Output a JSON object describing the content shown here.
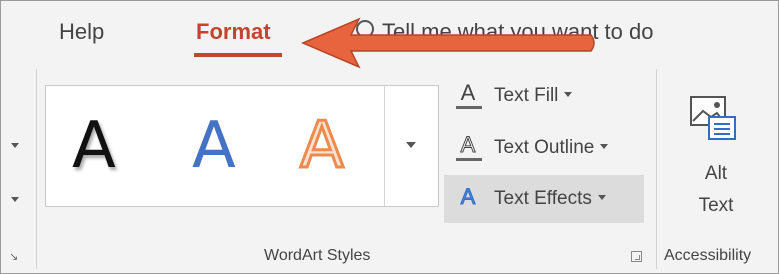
{
  "tabs": {
    "help_label": "Help",
    "format_label": "Format",
    "tellme_text": "Tell me what you want to do"
  },
  "wordart": {
    "styles": [
      {
        "glyph": "A",
        "style": "black-shadow"
      },
      {
        "glyph": "A",
        "style": "blue-fill"
      },
      {
        "glyph": "A",
        "style": "orange-outline"
      }
    ],
    "group_label": "WordArt Styles"
  },
  "commands": {
    "text_fill": "Text Fill",
    "text_outline": "Text Outline",
    "text_effects": "Text Effects",
    "glyph": "A"
  },
  "accessibility": {
    "alt_text_line1": "Alt",
    "alt_text_line2": "Text",
    "group_label": "Accessibility"
  },
  "colors": {
    "accent": "#c4452e",
    "annotation_arrow": "#e8643f",
    "wordart_blue": "#4472c4",
    "wordart_orange": "#ee8a4c"
  }
}
